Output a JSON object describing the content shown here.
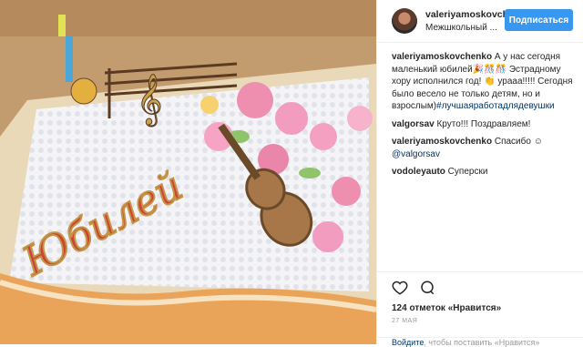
{
  "header": {
    "username": "valeriyamoskovch",
    "location": "Межшкольный ...",
    "follow_label": "Подписаться"
  },
  "comments": [
    {
      "user": "valeriyamoskovchenko",
      "text": " А у нас сегодня маленький юбилей🎉🎊🎊 Эстрадному хору исполнился год! 👏 урааа!!!!! Сегодня было весело не только детям, но и взрослым)",
      "tag": "#лучшаяработадлядевушки"
    },
    {
      "user": "valgorsav",
      "text": " Круто!!! Поздравляем!",
      "tag": ""
    },
    {
      "user": "valeriyamoskovchenko",
      "text": " Спасибо ☺ ",
      "tag": "@valgorsav"
    },
    {
      "user": "vodoleyauto",
      "text": " Суперски",
      "tag": ""
    }
  ],
  "likes_text": "124 отметок «Нравится»",
  "date": "27 МАЯ",
  "login_prompt": {
    "link": "Войдите",
    "text": ", чтобы поставить «Нравится»"
  },
  "photo": {
    "cake_text": "Юбилей"
  },
  "colors": {
    "accent": "#3897f0",
    "link": "#003569"
  },
  "icons": [
    "heart-icon",
    "comment-icon"
  ]
}
